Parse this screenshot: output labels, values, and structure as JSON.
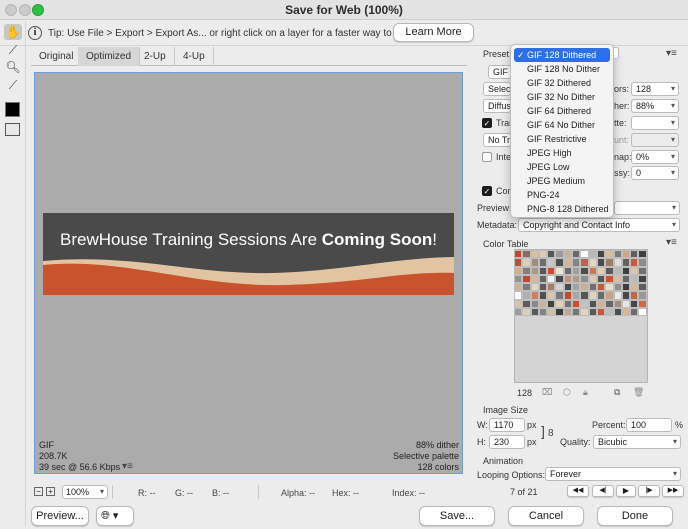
{
  "window": {
    "title": "Save for Web (100%)"
  },
  "tip": {
    "text": "Tip: Use File > Export > Export As...  or right click on a layer for a faster way to export assets",
    "learn_more": "Learn More"
  },
  "tabs": [
    "Original",
    "Optimized",
    "2-Up",
    "4-Up"
  ],
  "banner": {
    "text_regular": "BrewHouse Training Sessions Are ",
    "text_bold": "Coming Soon",
    "text_end": "!"
  },
  "image_info": {
    "format": "GIF",
    "size": "208.7K",
    "time": "39 sec @ 56.6 Kbps",
    "dither": "88% dither",
    "palette": "Selective palette",
    "colors": "128 colors"
  },
  "statusbar": {
    "zoom": "100%",
    "r": "R: --",
    "g": "G: --",
    "b": "B: --",
    "alpha": "Alpha: --",
    "hex": "Hex: --",
    "index": "Index: --"
  },
  "bottom": {
    "preview": "Preview...",
    "save": "Save...",
    "cancel": "Cancel",
    "done": "Done"
  },
  "settings": {
    "preset_label": "Preset:",
    "format_value": "GIF",
    "reduction_value": "Selec",
    "colors_label": "ors:",
    "colors_value": "128",
    "dither_algo_value": "Diffus",
    "dither_label": "her:",
    "dither_value": "88%",
    "transparency_label": "Tran",
    "matte_label": "tte:",
    "no_trans_value": "No Tra",
    "amount_label": "unt:",
    "interlaced_label": "Inte",
    "web_snap_label": "nap:",
    "web_snap_value": "0%",
    "lossy_label": "ssy:",
    "lossy_value": "0",
    "convert_label": "Con",
    "preview_label": "Preview:",
    "metadata_label": "Metadata:",
    "metadata_value": "Copyright and Contact Info"
  },
  "preset_menu": {
    "selected": "GIF 128 Dithered",
    "options": [
      "GIF 128 Dithered",
      "GIF 128 No Dither",
      "GIF 32 Dithered",
      "GIF 32 No Dither",
      "GIF 64 Dithered",
      "GIF 64 No Dither",
      "GIF Restrictive",
      "JPEG High",
      "JPEG Low",
      "JPEG Medium",
      "PNG-24",
      "PNG-8 128 Dithered"
    ]
  },
  "color_table": {
    "title": "Color Table",
    "count": "128",
    "colors": [
      "#c8452a",
      "#8a6a5a",
      "#d9c1a0",
      "#e0cbb0",
      "#575757",
      "#9a9a9a",
      "#c6b29a",
      "#6a6a6a",
      "#ffffff",
      "#b8b8b8",
      "#444444",
      "#d7bda0",
      "#7a7a7a",
      "#cfa88a",
      "#5e5e5e",
      "#3f3f3f",
      "#b5533a",
      "#e0cfbd",
      "#9e8e80",
      "#6d6d6d",
      "#c7c7c7",
      "#505050",
      "#d9b397",
      "#848484",
      "#ba624a",
      "#e5d6c4",
      "#4c4c4c",
      "#9a7d6b",
      "#dddddd",
      "#616161",
      "#c65e3c",
      "#8c8c8c",
      "#d0b090",
      "#7f7f7f",
      "#a99888",
      "#575757",
      "#d3492b",
      "#efe3d3",
      "#6b6b6b",
      "#a0a0a0",
      "#4d4d4d",
      "#c67a5c",
      "#e1cdb6",
      "#5a5a5a",
      "#b8b8b8",
      "#3e3e3e",
      "#dec6aa",
      "#717171",
      "#939393",
      "#c8452a",
      "#d5b79b",
      "#646464",
      "#f0f0f0",
      "#494949",
      "#c49478",
      "#ab9c8d",
      "#8e8e8e",
      "#dacab6",
      "#555555",
      "#cf5133",
      "#d8bda2",
      "#666666",
      "#bcbcbc",
      "#444444",
      "#c9b49a",
      "#7c7c7c",
      "#e4d5c1",
      "#5c5c5c",
      "#ae7a62",
      "#d3d3d3",
      "#4a4a4a",
      "#a3a3a3",
      "#ccae90",
      "#6f6f6f",
      "#c55a3b",
      "#e8dccb",
      "#8f8f8f",
      "#3d3d3d",
      "#d6b89c",
      "#5f5f5f",
      "#ffffff",
      "#b0b0b0",
      "#cf7f5f",
      "#4f4f4f",
      "#dbc4a9",
      "#787878",
      "#c74c2e",
      "#a6a6a6",
      "#555555",
      "#ddd2c4",
      "#6b6b6b",
      "#c2a486",
      "#e9e9e9",
      "#484848",
      "#b96b50",
      "#999999",
      "#d8c3aa",
      "#5d5d5d",
      "#8a8a8a",
      "#cbb39a",
      "#414141",
      "#e3d0b9",
      "#737373",
      "#d24d2f",
      "#c3c3c3",
      "#525252",
      "#d1b293",
      "#676767",
      "#aa8b78",
      "#e6e6e6",
      "#464646",
      "#cc6a4b",
      "#9d9d9d",
      "#dfcdb8",
      "#5b5b5b",
      "#838383",
      "#d6be9f",
      "#3c3c3c",
      "#c1a991",
      "#757575",
      "#e2d4c4",
      "#595959",
      "#c7583a",
      "#bdbdbd",
      "#4e4e4e",
      "#d4b597",
      "#6e6e6e",
      "#ffffff"
    ]
  },
  "image_size": {
    "title": "Image Size",
    "w_label": "W:",
    "w_value": "1170",
    "h_label": "H:",
    "h_value": "230",
    "unit": "px",
    "percent_label": "Percent:",
    "percent_value": "100",
    "percent_unit": "%",
    "quality_label": "Quality:",
    "quality_value": "Bicubic"
  },
  "animation": {
    "title": "Animation",
    "looping_label": "Looping Options:",
    "looping_value": "Forever",
    "frame": "7 of 21"
  }
}
